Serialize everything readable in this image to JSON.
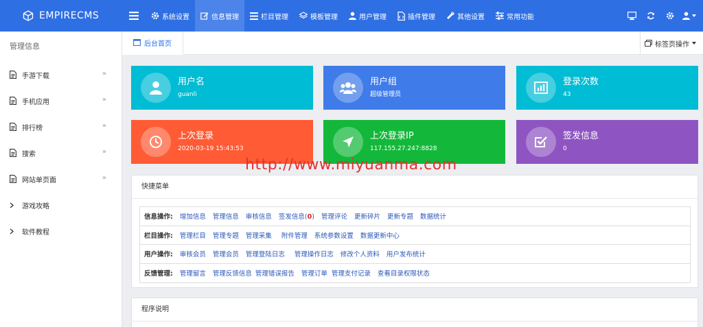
{
  "brand": "EMPIRECMS",
  "nav": [
    {
      "label": "系统设置",
      "icon": "gear-icon"
    },
    {
      "label": "信息管理",
      "icon": "edit-icon",
      "active": true
    },
    {
      "label": "栏目管理",
      "icon": "list-icon"
    },
    {
      "label": "模板管理",
      "icon": "layers-icon"
    },
    {
      "label": "用户管理",
      "icon": "user-icon"
    },
    {
      "label": "插件管理",
      "icon": "plugin-file-icon"
    },
    {
      "label": "其他设置",
      "icon": "wrench-icon"
    },
    {
      "label": "常用功能",
      "icon": "sliders-icon"
    }
  ],
  "sidebar": {
    "title": "管理信息",
    "items": [
      {
        "label": "手游下载",
        "icon": "file-icon",
        "arrow": "»"
      },
      {
        "label": "手机应用",
        "icon": "file-icon",
        "arrow": "»"
      },
      {
        "label": "排行榜",
        "icon": "file-icon",
        "arrow": "»"
      },
      {
        "label": "搜索",
        "icon": "file-icon",
        "arrow": "»"
      },
      {
        "label": "网站单页面",
        "icon": "file-icon",
        "arrow": "»"
      },
      {
        "label": "游戏攻略",
        "icon": "chevron-right-icon",
        "arrow": ""
      },
      {
        "label": "软件教程",
        "icon": "chevron-right-icon",
        "arrow": ""
      }
    ]
  },
  "tabs": {
    "home": "后台首页",
    "ops": "标签页操作"
  },
  "cards": [
    {
      "title": "用户名",
      "value": "guanli",
      "color": "#00bcd4",
      "icon": "user-icon"
    },
    {
      "title": "用户组",
      "value": "超级管理员",
      "color": "#3f7be9",
      "icon": "group-icon"
    },
    {
      "title": "登录次数",
      "value": "43",
      "color": "#00bcd4",
      "icon": "bar-chart-icon"
    },
    {
      "title": "上次登录",
      "value": "2020-03-19 15:43:53",
      "color": "#ff5b35",
      "icon": "clock-icon"
    },
    {
      "title": "上次登录IP",
      "value": "117.155.27.247:8828",
      "color": "#13b83a",
      "icon": "location-arrow-icon"
    },
    {
      "title": "签发信息",
      "value": "0",
      "color": "#8e55c2",
      "icon": "check-square-icon"
    }
  ],
  "watermark": "http://www.miyuanma.com",
  "quick_menu": {
    "title": "快捷菜单",
    "rows": [
      {
        "label": "信息操作:",
        "links": [
          "增加信息",
          "管理信息",
          "审核信息",
          "签发信息",
          "管理评论",
          "更新碎片",
          "更新专题",
          "数据统计"
        ]
      },
      {
        "label": "栏目操作:",
        "links": [
          "管理栏目",
          "管理专题",
          "管理采集",
          "附件管理",
          "系统参数设置",
          "数据更新中心"
        ]
      },
      {
        "label": "用户操作:",
        "links": [
          "审核会员",
          "管理会员",
          "管理登陆日志",
          "管理操作日志",
          "修改个人资料",
          "用户发布统计"
        ]
      },
      {
        "label": "反馈管理:",
        "links": [
          "管理留言",
          "管理反馈信息",
          "管理错误报告",
          "管理订单",
          "管理支付记录",
          "查看目录权限状态"
        ]
      }
    ],
    "pending_count": "0"
  },
  "program_info": {
    "title": "程序说明"
  }
}
